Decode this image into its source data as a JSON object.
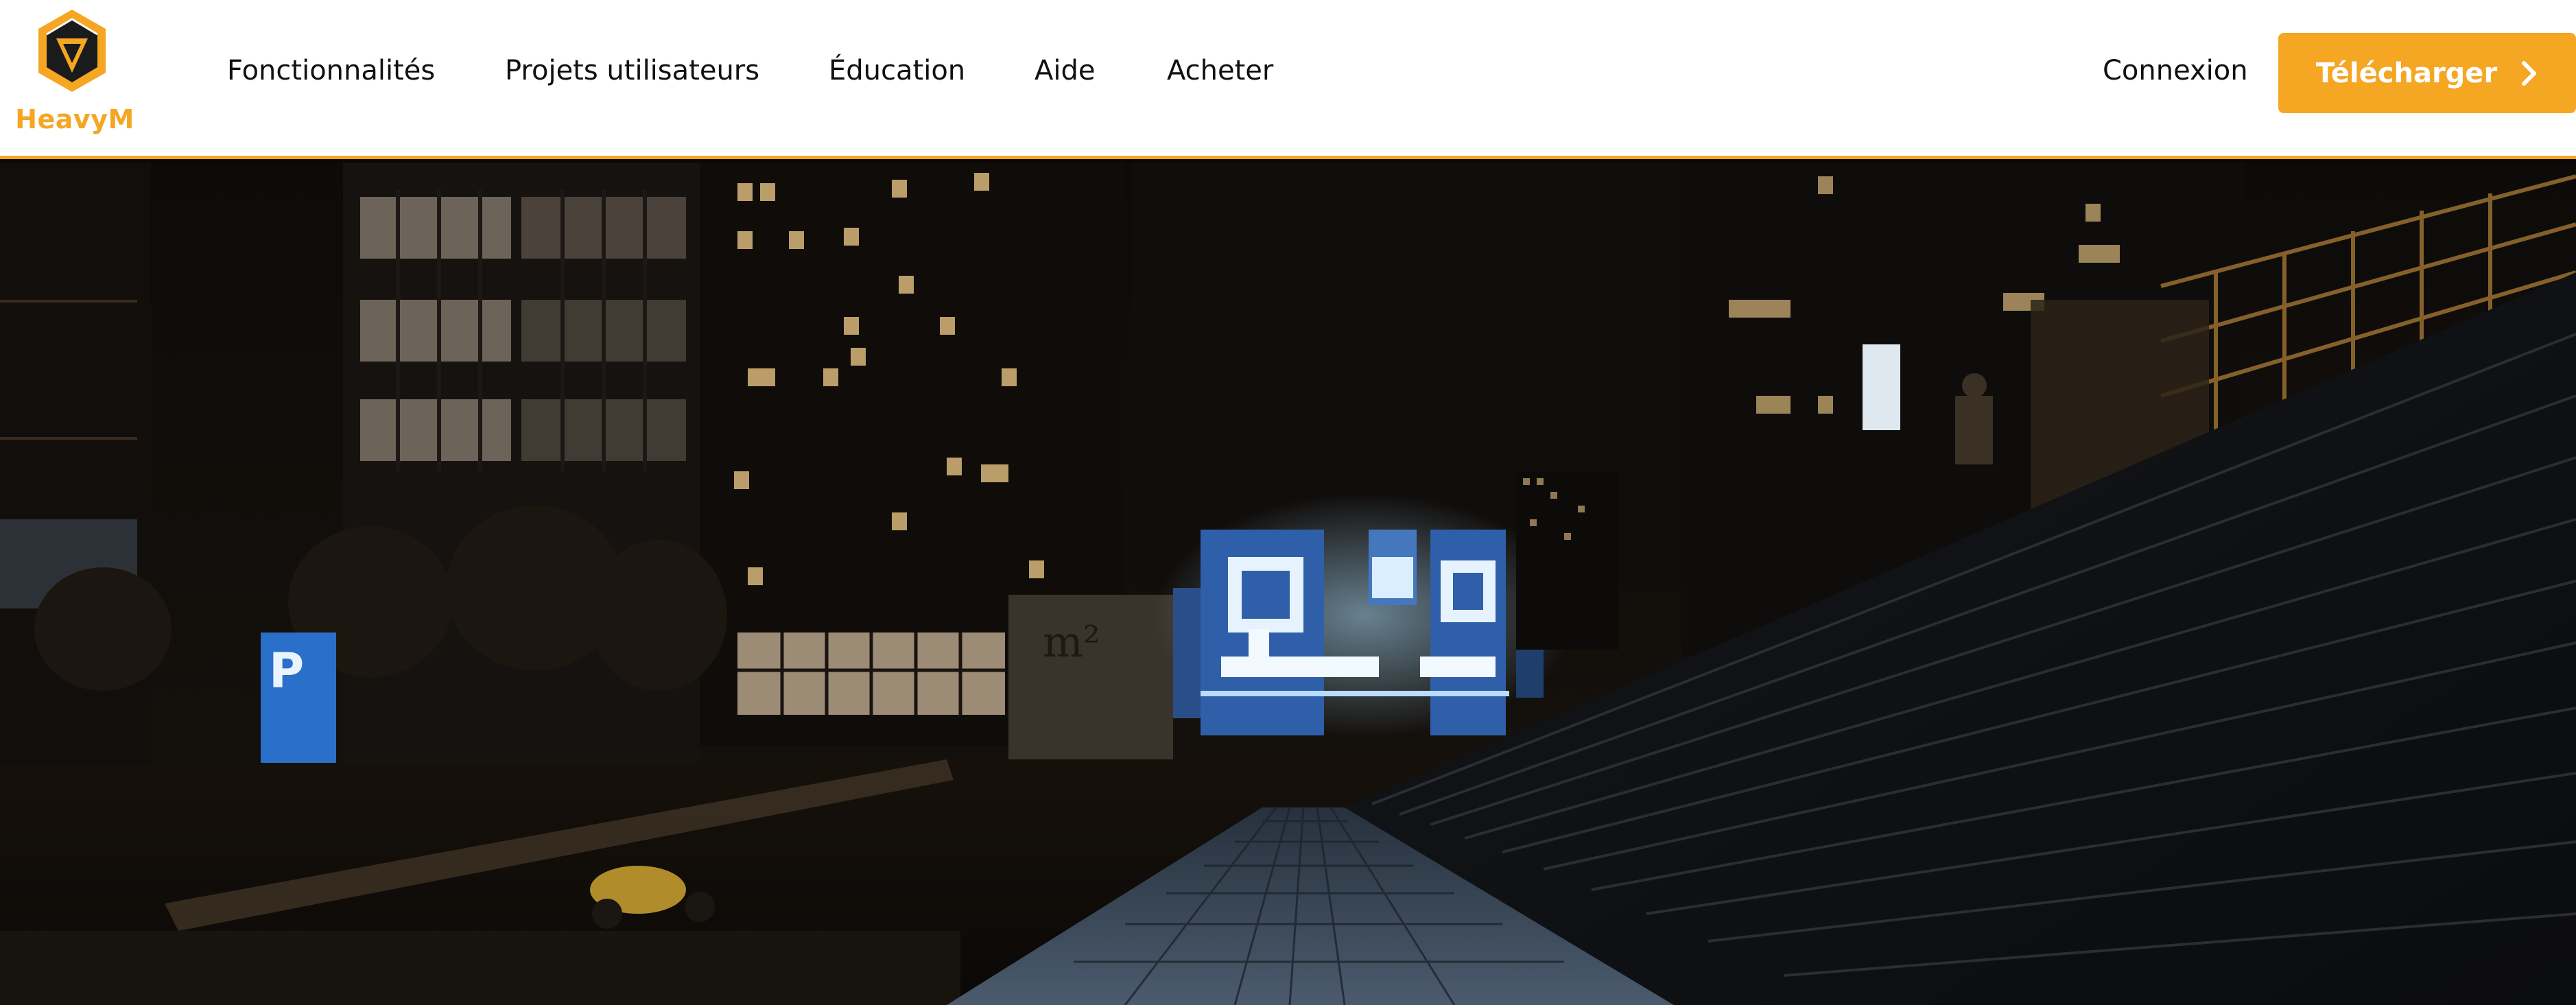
{
  "brand": {
    "name": "HeavyM",
    "accent_color": "#f5a623",
    "logo_icon": "heavym-logo-icon"
  },
  "nav": {
    "items": [
      {
        "label": "Fonctionnalités"
      },
      {
        "label": "Projets utilisateurs"
      },
      {
        "label": "Éducation"
      },
      {
        "label": "Aide"
      },
      {
        "label": "Acheter"
      }
    ]
  },
  "actions": {
    "login_label": "Connexion",
    "download_label": "Télécharger",
    "download_icon": "chevron-right-icon"
  },
  "hero": {
    "alt_scene": "night-city-plaza-projection-mapping",
    "building_sign_text": "m²"
  }
}
